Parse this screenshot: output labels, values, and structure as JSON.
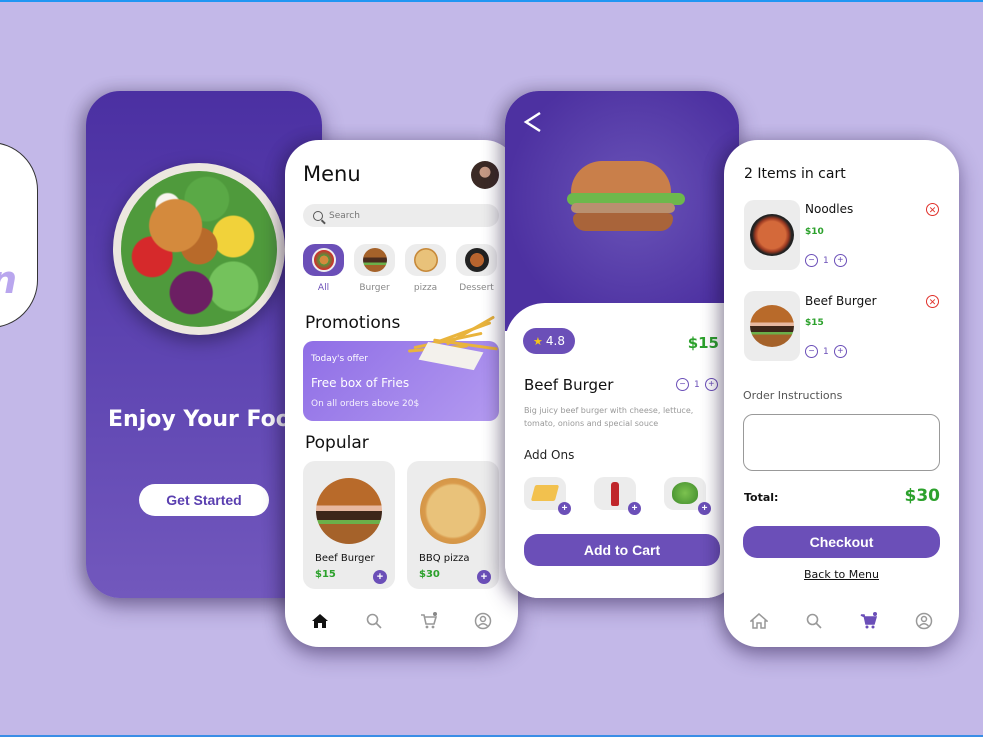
{
  "splash": {
    "title": "Enjoy Your Food",
    "cta": "Get Started"
  },
  "menu": {
    "title": "Menu",
    "search_placeholder": "Search",
    "categories": [
      {
        "label": "All",
        "active": true
      },
      {
        "label": "Burger",
        "active": false
      },
      {
        "label": "pizza",
        "active": false
      },
      {
        "label": "Dessert",
        "active": false
      }
    ],
    "promotions_title": "Promotions",
    "promo": {
      "kicker": "Today's offer",
      "headline": "Free box of Fries",
      "note": "On all orders above 20$"
    },
    "popular_title": "Popular",
    "popular": [
      {
        "name": "Beef Burger",
        "price": "$15"
      },
      {
        "name": "BBQ pizza",
        "price": "$30"
      }
    ],
    "nav": [
      "home",
      "search",
      "cart",
      "profile"
    ],
    "active_nav": "home"
  },
  "detail": {
    "rating": "4.8",
    "price": "$15",
    "name": "Beef Burger",
    "quantity": "1",
    "description": "Big juicy beef burger with cheese, lettuce, tomato, onions and special souce",
    "addons_title": "Add Ons",
    "addons": [
      "cheese",
      "ketchup",
      "lettuce"
    ],
    "cta": "Add to Cart"
  },
  "cart": {
    "title": "2 Items in cart",
    "items": [
      {
        "name": "Noodles",
        "price": "$10",
        "quantity": "1"
      },
      {
        "name": "Beef Burger",
        "price": "$15",
        "quantity": "1"
      }
    ],
    "instructions_label": "Order Instructions",
    "instructions_value": "",
    "total_label": "Total:",
    "total_value": "$30",
    "checkout": "Checkout",
    "back_link": "Back to Menu",
    "active_nav": "cart"
  },
  "colors": {
    "background": "#c3b8e8",
    "accent": "#6b4fb8",
    "price_green": "#2ca12c",
    "remove_red": "#e0302a"
  }
}
